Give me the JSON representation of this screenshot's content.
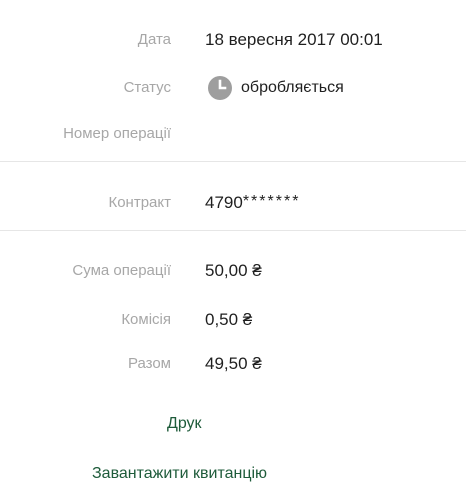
{
  "details": {
    "date": {
      "label": "Дата",
      "value": "18 вересня 2017 00:01"
    },
    "status": {
      "label": "Статус",
      "value": "обробляється",
      "icon": "clock-icon",
      "icon_color": "#9e9e9e"
    },
    "operation_number": {
      "label": "Номер операції",
      "value": ""
    }
  },
  "contract": {
    "label": "Контракт",
    "prefix": "4790",
    "mask": "*******"
  },
  "amounts": {
    "sum": {
      "label": "Сума операції",
      "value": "50,00 ₴"
    },
    "fee": {
      "label": "Комісія",
      "value": "0,50 ₴"
    },
    "total": {
      "label": "Разом",
      "value": "49,50 ₴"
    }
  },
  "actions": {
    "print_label": "Друк",
    "download_receipt_label": "Завантажити квитанцію"
  },
  "colors": {
    "label": "#a7a7a7",
    "value": "#1f1f1f",
    "action": "#1e5b3a",
    "divider": "#e6e6e6"
  }
}
